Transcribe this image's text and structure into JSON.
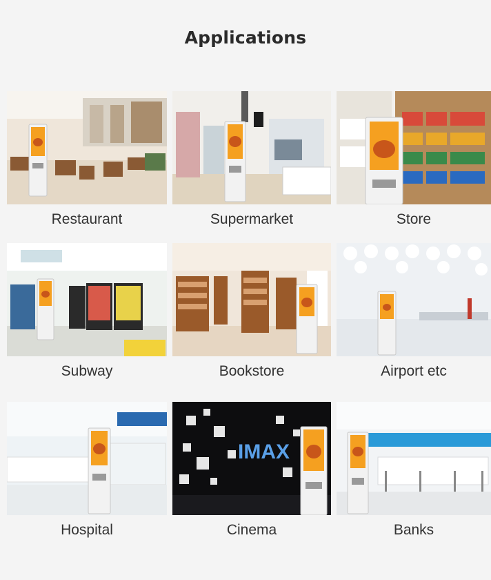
{
  "header": {
    "title": "Applications"
  },
  "applications": [
    {
      "label": "Restaurant",
      "photo": "restaurant-photo"
    },
    {
      "label": "Supermarket",
      "photo": "supermarket-photo"
    },
    {
      "label": "Store",
      "photo": "store-photo"
    },
    {
      "label": "Subway",
      "photo": "subway-photo"
    },
    {
      "label": "Bookstore",
      "photo": "bookstore-photo"
    },
    {
      "label": "Airport etc",
      "photo": "airport-photo"
    },
    {
      "label": "Hospital",
      "photo": "hospital-photo"
    },
    {
      "label": "Cinema",
      "photo": "cinema-photo",
      "sign_text": "IMAX"
    },
    {
      "label": "Banks",
      "photo": "bank-photo"
    }
  ],
  "kiosk": {
    "screen_color": "#f5a020",
    "burger_color": "#c8561a",
    "body_color": "#f2f2f2"
  }
}
